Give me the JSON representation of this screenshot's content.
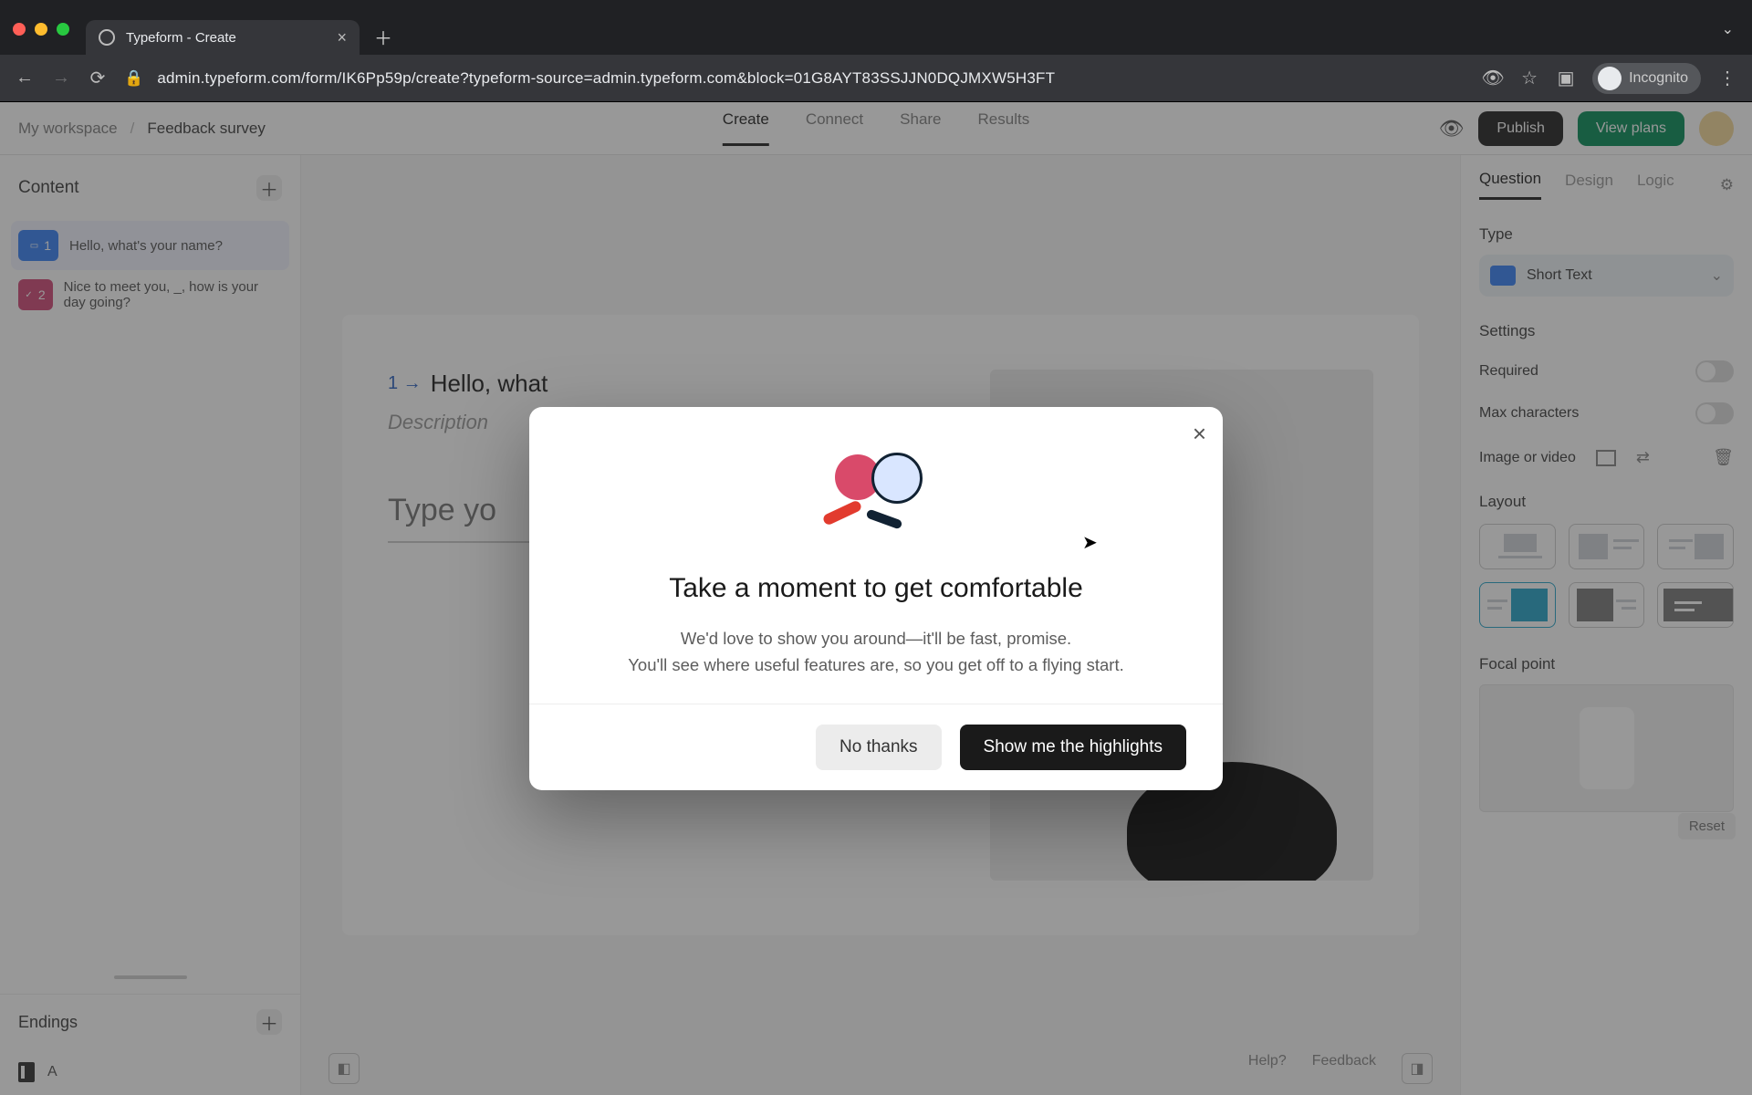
{
  "browser": {
    "tab_title": "Typeform - Create",
    "url": "admin.typeform.com/form/IK6Pp59p/create?typeform-source=admin.typeform.com&block=01G8AYT83SSJJN0DQJMXW5H3FT",
    "incognito_label": "Incognito"
  },
  "breadcrumbs": {
    "workspace": "My workspace",
    "form": "Feedback survey"
  },
  "nav_tabs": {
    "create": "Create",
    "connect": "Connect",
    "share": "Share",
    "results": "Results"
  },
  "topbar": {
    "publish": "Publish",
    "view_plans": "View plans"
  },
  "left": {
    "content_title": "Content",
    "items": [
      {
        "num": "1",
        "text": "Hello, what's your name?",
        "color": "blue",
        "selected": true
      },
      {
        "num": "2",
        "text": "Nice to meet you, _, how is your day going?",
        "color": "pink",
        "selected": false
      }
    ],
    "endings_title": "Endings",
    "ending_label": "A"
  },
  "canvas": {
    "q_number": "1 →",
    "q_text": "Hello, what",
    "desc_placeholder": "Description",
    "input_placeholder": "Type yo",
    "help": "Help?",
    "feedback": "Feedback"
  },
  "right": {
    "tabs": {
      "question": "Question",
      "design": "Design",
      "logic": "Logic"
    },
    "type_title": "Type",
    "type_value": "Short Text",
    "settings_title": "Settings",
    "required_label": "Required",
    "maxchars_label": "Max characters",
    "imgvid_label": "Image or video",
    "layout_title": "Layout",
    "focal_title": "Focal point",
    "reset_label": "Reset"
  },
  "modal": {
    "title": "Take a moment to get comfortable",
    "line1": "We'd love to show you around—it'll be fast, promise.",
    "line2": "You'll see where useful features are, so you get off to a flying start.",
    "no_thanks": "No thanks",
    "show_me": "Show me the highlights"
  }
}
